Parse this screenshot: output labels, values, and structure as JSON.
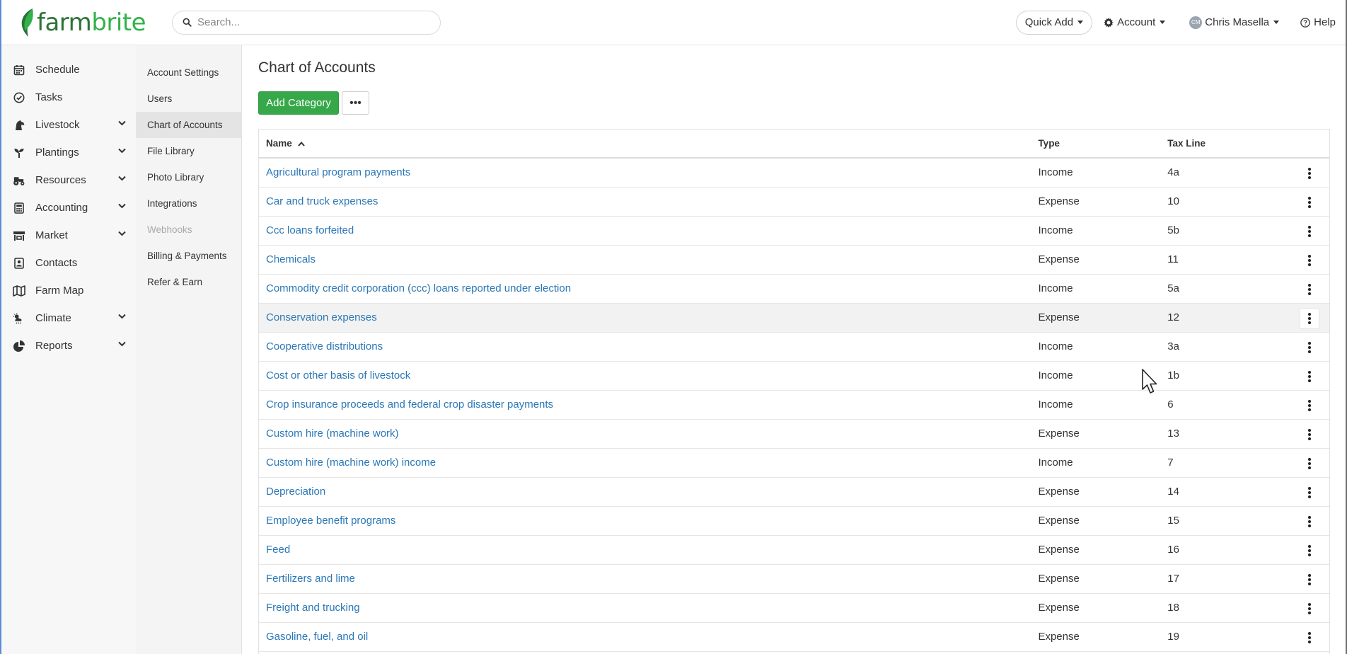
{
  "brand": {
    "name_part1": "farm",
    "name_part2": "brite",
    "color": "#31b24b"
  },
  "header": {
    "search_placeholder": "Search...",
    "quick_add": "Quick Add",
    "account": "Account",
    "user_initials": "CM",
    "user_name": "Chris Masella",
    "help": "Help"
  },
  "sidebar": {
    "items": [
      {
        "label": "Schedule",
        "icon": "calendar-icon",
        "expandable": false
      },
      {
        "label": "Tasks",
        "icon": "check-circle-icon",
        "expandable": false
      },
      {
        "label": "Livestock",
        "icon": "horse-icon",
        "expandable": true
      },
      {
        "label": "Plantings",
        "icon": "seedling-icon",
        "expandable": true
      },
      {
        "label": "Resources",
        "icon": "tractor-icon",
        "expandable": true
      },
      {
        "label": "Accounting",
        "icon": "calculator-icon",
        "expandable": true
      },
      {
        "label": "Market",
        "icon": "store-icon",
        "expandable": true
      },
      {
        "label": "Contacts",
        "icon": "contact-card-icon",
        "expandable": false
      },
      {
        "label": "Farm Map",
        "icon": "map-icon",
        "expandable": false
      },
      {
        "label": "Climate",
        "icon": "weather-icon",
        "expandable": true
      },
      {
        "label": "Reports",
        "icon": "pie-chart-icon",
        "expandable": true
      }
    ]
  },
  "settings_nav": {
    "items": [
      {
        "label": "Account Settings",
        "active": false,
        "disabled": false
      },
      {
        "label": "Users",
        "active": false,
        "disabled": false
      },
      {
        "label": "Chart of Accounts",
        "active": true,
        "disabled": false
      },
      {
        "label": "File Library",
        "active": false,
        "disabled": false
      },
      {
        "label": "Photo Library",
        "active": false,
        "disabled": false
      },
      {
        "label": "Integrations",
        "active": false,
        "disabled": false
      },
      {
        "label": "Webhooks",
        "active": false,
        "disabled": true
      },
      {
        "label": "Billing & Payments",
        "active": false,
        "disabled": false
      },
      {
        "label": "Refer & Earn",
        "active": false,
        "disabled": false
      }
    ]
  },
  "main": {
    "title": "Chart of Accounts",
    "add_button": "Add Category",
    "more_button": "•••",
    "table": {
      "columns": [
        "Name",
        "Type",
        "Tax Line"
      ],
      "rows": [
        {
          "name": "Agricultural program payments",
          "type": "Income",
          "tax_line": "4a"
        },
        {
          "name": "Car and truck expenses",
          "type": "Expense",
          "tax_line": "10"
        },
        {
          "name": "Ccc loans forfeited",
          "type": "Income",
          "tax_line": "5b"
        },
        {
          "name": "Chemicals",
          "type": "Expense",
          "tax_line": "11"
        },
        {
          "name": "Commodity credit corporation (ccc) loans reported under election",
          "type": "Income",
          "tax_line": "5a"
        },
        {
          "name": "Conservation expenses",
          "type": "Expense",
          "tax_line": "12",
          "hovered": true
        },
        {
          "name": "Cooperative distributions",
          "type": "Income",
          "tax_line": "3a"
        },
        {
          "name": "Cost or other basis of livestock",
          "type": "Income",
          "tax_line": "1b"
        },
        {
          "name": "Crop insurance proceeds and federal crop disaster payments",
          "type": "Income",
          "tax_line": "6"
        },
        {
          "name": "Custom hire (machine work)",
          "type": "Expense",
          "tax_line": "13"
        },
        {
          "name": "Custom hire (machine work) income",
          "type": "Income",
          "tax_line": "7"
        },
        {
          "name": "Depreciation",
          "type": "Expense",
          "tax_line": "14"
        },
        {
          "name": "Employee benefit programs",
          "type": "Expense",
          "tax_line": "15"
        },
        {
          "name": "Feed",
          "type": "Expense",
          "tax_line": "16"
        },
        {
          "name": "Fertilizers and lime",
          "type": "Expense",
          "tax_line": "17"
        },
        {
          "name": "Freight and trucking",
          "type": "Expense",
          "tax_line": "18"
        },
        {
          "name": "Gasoline, fuel, and oil",
          "type": "Expense",
          "tax_line": "19"
        }
      ]
    }
  }
}
